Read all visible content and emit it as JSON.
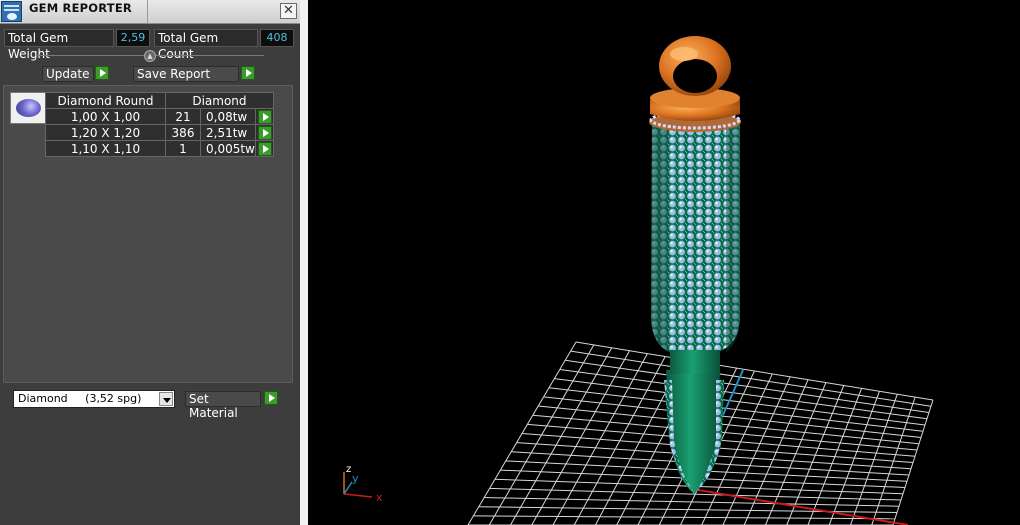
{
  "window": {
    "title": "GEM REPORTER",
    "close_glyph": "✕"
  },
  "stats": {
    "total_weight_label": "Total Gem Weight",
    "total_weight_value": "2,59",
    "total_count_label": "Total Gem Count",
    "total_count_value": "408"
  },
  "actions": {
    "update_label": "Update",
    "save_report_label": "Save Report"
  },
  "gem_group": {
    "icon": "round-diamond-icon",
    "headers": [
      "Diamond Round",
      "Diamond"
    ],
    "rows": [
      {
        "size": "1,00 X 1,00",
        "count": "21",
        "weight": "0,08tw"
      },
      {
        "size": "1,20 X 1,20",
        "count": "386",
        "weight": "2,51tw"
      },
      {
        "size": "1,10 X 1,10",
        "count": "1",
        "weight": "0,005tw"
      }
    ]
  },
  "material": {
    "selected": "Diamond     (3,52 spg)",
    "set_label": "Set Material"
  },
  "viewport": {
    "axis_labels": {
      "x": "x",
      "y": "y",
      "z": "z"
    },
    "colors": {
      "grid": "#d8d8d8",
      "metal_body": "#0f7d5a",
      "metal_top": "#d9701f",
      "gem": "#8fb2d8",
      "x_axis": "#cc1a1a",
      "y_axis": "#1f8fc7"
    }
  },
  "colors": {
    "panel_bg": "#3d3d3d",
    "value_text": "#4fc1d8",
    "go_button": "#3d9a2c"
  }
}
